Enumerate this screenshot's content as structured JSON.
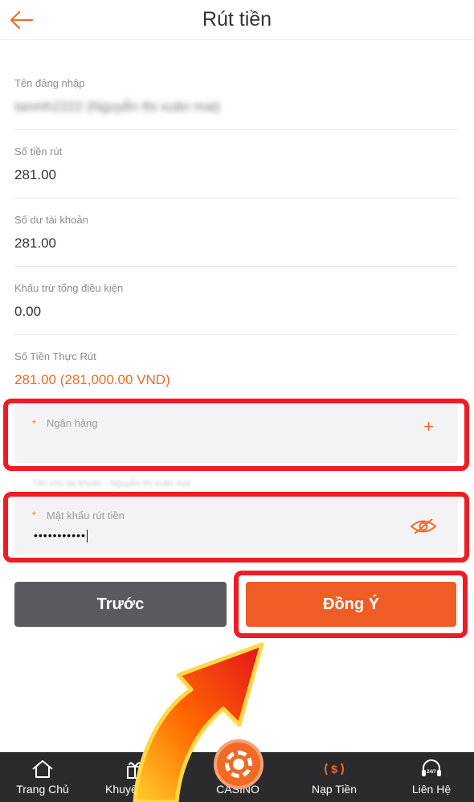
{
  "header": {
    "title": "Rút tiền",
    "back_icon": "arrow-left-icon",
    "accent": "#f06a25"
  },
  "fields": {
    "username": {
      "label": "Tên đăng nhập",
      "value": "tanmh2222 (Nguyễn thị xuân mai)"
    },
    "withdraw_amount": {
      "label": "Số tiền rút",
      "value": "281.00"
    },
    "balance": {
      "label": "Số dư tài khoản",
      "value": "281.00"
    },
    "deduction": {
      "label": "Khấu trừ tổng điều kiện",
      "value": "0.00"
    },
    "actual": {
      "label": "Số Tiền Thực Rút",
      "value": "281.00 (281,000.00 VND)"
    }
  },
  "bank": {
    "required_mark": "*",
    "placeholder": "Ngân hàng",
    "add_symbol": "+"
  },
  "hint": "Tên chủ tài khoản : Nguyễn thị xuân mai",
  "password": {
    "required_mark": "*",
    "placeholder": "Mật khẩu rút tiền",
    "value": "•••••••••••"
  },
  "buttons": {
    "prev": "Trước",
    "confirm": "Đồng Ý"
  },
  "tabbar": [
    {
      "label": "Trang Chủ",
      "icon": "home-icon"
    },
    {
      "label": "Khuyến Mãi",
      "icon": "gift-icon"
    },
    {
      "label": "CASINO",
      "icon": "casino-chip-icon"
    },
    {
      "label": "Nạp Tiền",
      "icon": "deposit-icon"
    },
    {
      "label": "Liên Hệ",
      "icon": "support-24-7-icon"
    }
  ],
  "colors": {
    "highlight": "#ee1c25",
    "confirm": "#ef5d26",
    "prev": "#5b5b5f",
    "tabbar": "#2b2b2d"
  }
}
